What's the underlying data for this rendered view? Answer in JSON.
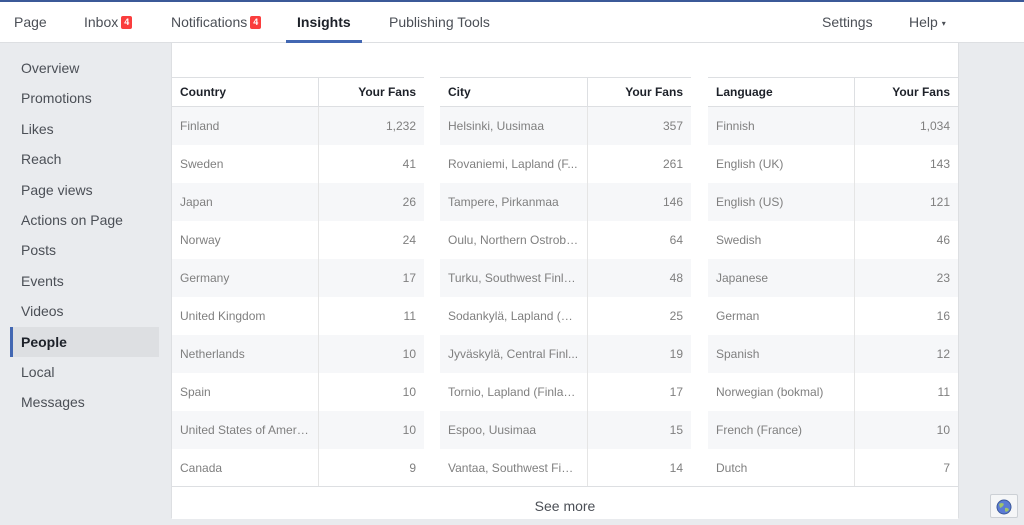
{
  "nav": {
    "page": "Page",
    "inbox": "Inbox",
    "inbox_badge": "4",
    "notifications": "Notifications",
    "notifications_badge": "4",
    "insights": "Insights",
    "publishing_tools": "Publishing Tools",
    "settings": "Settings",
    "help": "Help",
    "help_caret": "▾"
  },
  "sidebar": {
    "items": [
      {
        "label": "Overview"
      },
      {
        "label": "Promotions"
      },
      {
        "label": "Likes"
      },
      {
        "label": "Reach"
      },
      {
        "label": "Page views"
      },
      {
        "label": "Actions on Page"
      },
      {
        "label": "Posts"
      },
      {
        "label": "Events"
      },
      {
        "label": "Videos"
      },
      {
        "label": "People",
        "active": true
      },
      {
        "label": "Local"
      },
      {
        "label": "Messages"
      }
    ]
  },
  "tables": {
    "country": {
      "col1": "Country",
      "col2": "Your Fans",
      "rows": [
        {
          "name": "Finland",
          "fans": "1,232"
        },
        {
          "name": "Sweden",
          "fans": "41"
        },
        {
          "name": "Japan",
          "fans": "26"
        },
        {
          "name": "Norway",
          "fans": "24"
        },
        {
          "name": "Germany",
          "fans": "17"
        },
        {
          "name": "United Kingdom",
          "fans": "11"
        },
        {
          "name": "Netherlands",
          "fans": "10"
        },
        {
          "name": "Spain",
          "fans": "10"
        },
        {
          "name": "United States of America",
          "fans": "10"
        },
        {
          "name": "Canada",
          "fans": "9"
        }
      ]
    },
    "city": {
      "col1": "City",
      "col2": "Your Fans",
      "rows": [
        {
          "name": "Helsinki, Uusimaa",
          "fans": "357"
        },
        {
          "name": "Rovaniemi, Lapland (F...",
          "fans": "261"
        },
        {
          "name": "Tampere, Pirkanmaa",
          "fans": "146"
        },
        {
          "name": "Oulu, Northern Ostrobo...",
          "fans": "64"
        },
        {
          "name": "Turku, Southwest Finla...",
          "fans": "48"
        },
        {
          "name": "Sodankylä, Lapland (Fi...",
          "fans": "25"
        },
        {
          "name": "Jyväskylä, Central Finl...",
          "fans": "19"
        },
        {
          "name": "Tornio, Lapland (Finland)",
          "fans": "17"
        },
        {
          "name": "Espoo, Uusimaa",
          "fans": "15"
        },
        {
          "name": "Vantaa, Southwest Finl...",
          "fans": "14"
        }
      ]
    },
    "language": {
      "col1": "Language",
      "col2": "Your Fans",
      "rows": [
        {
          "name": "Finnish",
          "fans": "1,034"
        },
        {
          "name": "English (UK)",
          "fans": "143"
        },
        {
          "name": "English (US)",
          "fans": "121"
        },
        {
          "name": "Swedish",
          "fans": "46"
        },
        {
          "name": "Japanese",
          "fans": "23"
        },
        {
          "name": "German",
          "fans": "16"
        },
        {
          "name": "Spanish",
          "fans": "12"
        },
        {
          "name": "Norwegian (bokmal)",
          "fans": "11"
        },
        {
          "name": "French (France)",
          "fans": "10"
        },
        {
          "name": "Dutch",
          "fans": "7"
        }
      ]
    }
  },
  "footer": {
    "see_more": "See more"
  },
  "icons": {
    "globe": "globe-icon"
  },
  "colors": {
    "accent": "#4267b2",
    "badge": "#fa3e3e"
  }
}
